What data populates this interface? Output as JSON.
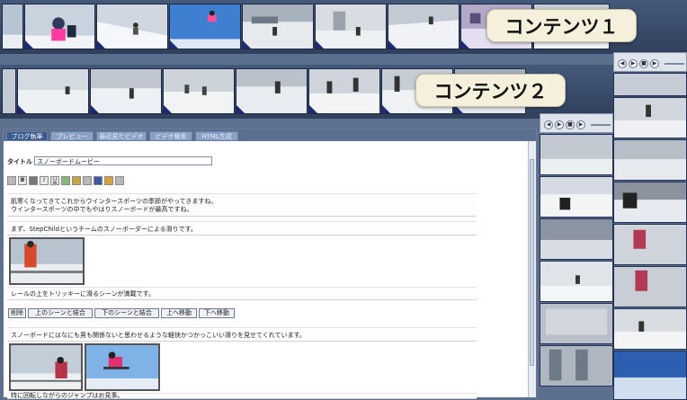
{
  "labels": {
    "content1": "コンテンツ１",
    "content2": "コンテンツ２"
  },
  "tabs": [
    {
      "label": "ブログ執筆",
      "active": true
    },
    {
      "label": "プレビュー",
      "active": false
    },
    {
      "label": "最近見たビデオ",
      "active": false
    },
    {
      "label": "ビデオ検索",
      "active": false
    },
    {
      "label": "HTML生成",
      "active": false
    }
  ],
  "editor": {
    "title_label": "タイトル",
    "title_value": "スノーボードムービー",
    "toolbar": {
      "bold": "B",
      "italic": "I",
      "underline": "U"
    },
    "paragraph1_line1": "肌寒くなってきてこれからウインタースポーツの季節がやってきますね。",
    "paragraph1_line2": "ウインタースポーツの中でもやはりスノーボードが最高ですね。",
    "paragraph2": "まず、StepChildというチームのスノーボーダーによる滑りです。",
    "caption1": "レールの上をトリッキーに滑るシーンが満載です。",
    "buttons": {
      "delete": "削除",
      "merge_up": "上のシーンと結合",
      "merge_down": "下のシーンと結合",
      "move_up": "上へ移動",
      "move_down": "下へ移動"
    },
    "paragraph3": "スノーボードにはなにも男も関係ないと思わせるような軽快かつかっこいい滑りを見せてくれています。",
    "caption2": "特に回転しながらのジャンプはお見事。"
  },
  "colors": {
    "accent_dark": "#1c2a78",
    "tab_active": "#3d5a8e",
    "tab_inactive": "#8aa0c4",
    "label_bg": "#f4f0dc"
  },
  "icons": [
    "play-icon",
    "rewind-icon",
    "forward-icon",
    "stop-icon"
  ]
}
